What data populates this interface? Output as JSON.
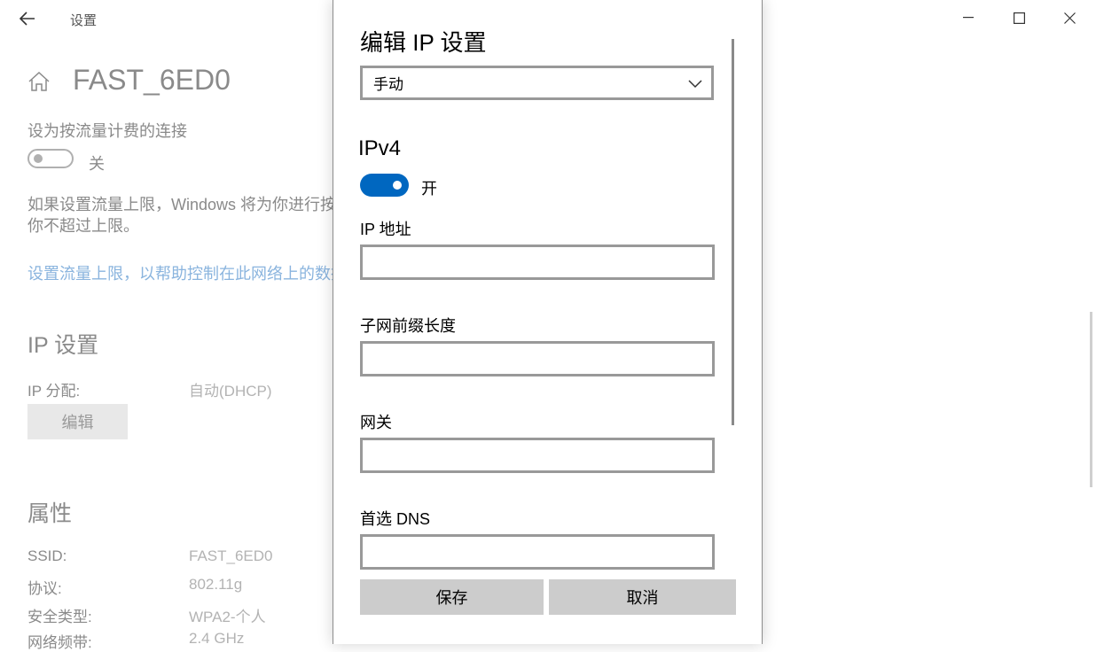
{
  "window": {
    "title": "设置",
    "controls": {
      "minimize": "minimize-icon",
      "maximize": "maximize-icon",
      "close": "close-icon"
    }
  },
  "background_page": {
    "network_name": "FAST_6ED0",
    "metered": {
      "label": "设为按流量计费的连接",
      "toggle_state": "关",
      "description_line1": "如果设置流量上限，Windows 将为你进行按流",
      "description_line2": "你不超过上限。",
      "link": "设置流量上限，以帮助控制在此网络上的数据"
    },
    "ip_settings": {
      "heading": "IP 设置",
      "assign_label": "IP 分配:",
      "assign_value": "自动(DHCP)",
      "edit_button": "编辑"
    },
    "properties": {
      "heading": "属性",
      "rows": [
        {
          "key": "SSID:",
          "value": "FAST_6ED0"
        },
        {
          "key": "协议:",
          "value": "802.11g"
        },
        {
          "key": "安全类型:",
          "value": "WPA2-个人"
        },
        {
          "key": "网络频带:",
          "value": "2.4 GHz"
        }
      ]
    }
  },
  "dialog": {
    "title": "编辑 IP 设置",
    "mode_select": {
      "value": "手动",
      "options": [
        "手动"
      ]
    },
    "ipv4": {
      "heading": "IPv4",
      "toggle_state": "开",
      "accent_color": "#0067c0"
    },
    "fields": [
      {
        "label": "IP 地址",
        "value": ""
      },
      {
        "label": "子网前缀长度",
        "value": ""
      },
      {
        "label": "网关",
        "value": ""
      },
      {
        "label": "首选 DNS",
        "value": ""
      }
    ],
    "buttons": {
      "save": "保存",
      "cancel": "取消"
    }
  }
}
